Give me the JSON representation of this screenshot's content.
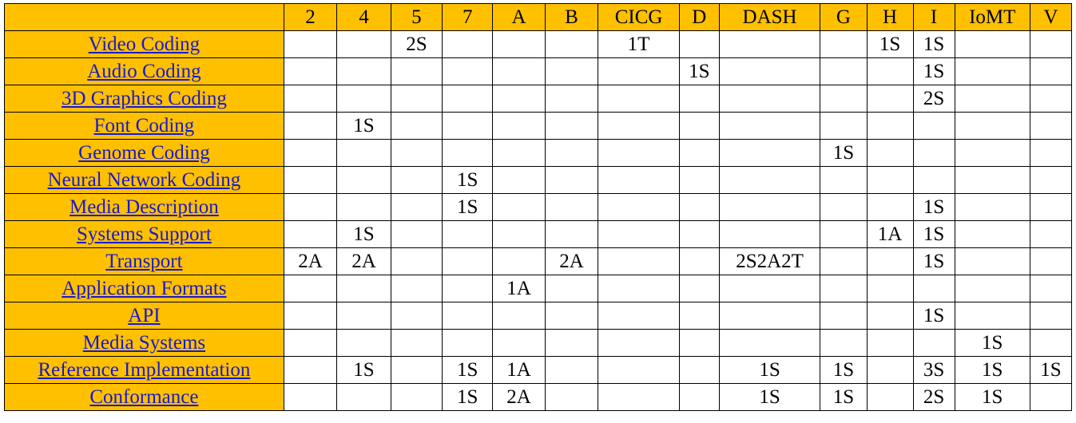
{
  "table": {
    "corner_label": "",
    "columns": [
      {
        "key": "2",
        "label": "2"
      },
      {
        "key": "4",
        "label": "4"
      },
      {
        "key": "5",
        "label": "5"
      },
      {
        "key": "7",
        "label": "7"
      },
      {
        "key": "A",
        "label": "A"
      },
      {
        "key": "B",
        "label": "B"
      },
      {
        "key": "CICG",
        "label": "CICG"
      },
      {
        "key": "D",
        "label": "D"
      },
      {
        "key": "DASH",
        "label": "DASH"
      },
      {
        "key": "G",
        "label": "G"
      },
      {
        "key": "H",
        "label": "H"
      },
      {
        "key": "I",
        "label": "I"
      },
      {
        "key": "IoMT",
        "label": "IoMT"
      },
      {
        "key": "V",
        "label": "V"
      }
    ],
    "rows": [
      {
        "label": "Video Coding",
        "cells": [
          "",
          "",
          "2S",
          "",
          "",
          "",
          "1T",
          "",
          "",
          "",
          "1S",
          "1S",
          "",
          ""
        ]
      },
      {
        "label": "Audio Coding",
        "cells": [
          "",
          "",
          "",
          "",
          "",
          "",
          "",
          "1S",
          "",
          "",
          "",
          "1S",
          "",
          ""
        ]
      },
      {
        "label": "3D Graphics Coding",
        "cells": [
          "",
          "",
          "",
          "",
          "",
          "",
          "",
          "",
          "",
          "",
          "",
          "2S",
          "",
          ""
        ]
      },
      {
        "label": "Font Coding",
        "cells": [
          "",
          "1S",
          "",
          "",
          "",
          "",
          "",
          "",
          "",
          "",
          "",
          "",
          "",
          ""
        ]
      },
      {
        "label": "Genome Coding",
        "cells": [
          "",
          "",
          "",
          "",
          "",
          "",
          "",
          "",
          "",
          "1S",
          "",
          "",
          "",
          ""
        ]
      },
      {
        "label": "Neural Network Coding",
        "cells": [
          "",
          "",
          "",
          "1S",
          "",
          "",
          "",
          "",
          "",
          "",
          "",
          "",
          "",
          ""
        ]
      },
      {
        "label": "Media Description",
        "cells": [
          "",
          "",
          "",
          "1S",
          "",
          "",
          "",
          "",
          "",
          "",
          "",
          "1S",
          "",
          ""
        ]
      },
      {
        "label": "Systems Support",
        "cells": [
          "",
          "1S",
          "",
          "",
          "",
          "",
          "",
          "",
          "",
          "",
          "1A",
          "1S",
          "",
          ""
        ]
      },
      {
        "label": "Transport",
        "cells": [
          "2A",
          "2A",
          "",
          "",
          "",
          "2A",
          "",
          "",
          "2S2A2T",
          "",
          "",
          "1S",
          "",
          ""
        ]
      },
      {
        "label": "Application Formats",
        "cells": [
          "",
          "",
          "",
          "",
          "1A",
          "",
          "",
          "",
          "",
          "",
          "",
          "",
          "",
          ""
        ]
      },
      {
        "label": "API",
        "cells": [
          "",
          "",
          "",
          "",
          "",
          "",
          "",
          "",
          "",
          "",
          "",
          "1S",
          "",
          ""
        ]
      },
      {
        "label": "Media Systems",
        "cells": [
          "",
          "",
          "",
          "",
          "",
          "",
          "",
          "",
          "",
          "",
          "",
          "",
          "1S",
          ""
        ]
      },
      {
        "label": "Reference Implementation",
        "cells": [
          "",
          "1S",
          "",
          "1S",
          "1A",
          "",
          "",
          "",
          "1S",
          "1S",
          "",
          "3S",
          "1S",
          "1S"
        ]
      },
      {
        "label": "Conformance",
        "cells": [
          "",
          "",
          "",
          "1S",
          "2A",
          "",
          "",
          "",
          "1S",
          "1S",
          "",
          "2S",
          "1S",
          ""
        ]
      }
    ]
  },
  "colors": {
    "header_background": "#FFC000",
    "link_text": "#1919CC",
    "cell_background": "#FFFFFF",
    "border": "#000000",
    "cell_text": "#000000"
  }
}
